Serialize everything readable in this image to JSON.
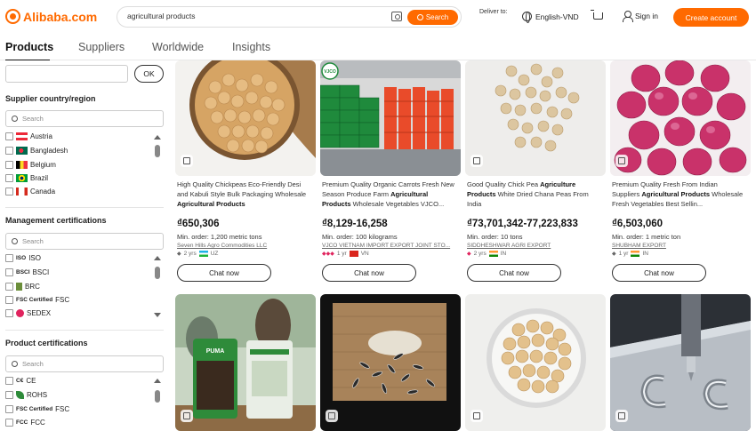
{
  "header": {
    "logo_text": "Alibaba.com",
    "search_value": "agricultural products",
    "search_button": "Search",
    "deliver_to": "Deliver to:",
    "language": "English-VND",
    "sign_in": "Sign in",
    "create_account": "Create account"
  },
  "tabs": [
    {
      "label": "Products",
      "active": true
    },
    {
      "label": "Suppliers",
      "active": false
    },
    {
      "label": "Worldwide",
      "active": false
    },
    {
      "label": "Insights",
      "active": false
    }
  ],
  "sidebar": {
    "ok_label": "OK",
    "country": {
      "title": "Supplier country/region",
      "search_placeholder": "Search",
      "options": [
        "Austria",
        "Bangladesh",
        "Belgium",
        "Brazil",
        "Canada"
      ]
    },
    "management": {
      "title": "Management certifications",
      "search_placeholder": "Search",
      "options": [
        {
          "badge": "ISO",
          "label": "ISO"
        },
        {
          "badge": "BSCI",
          "label": "BSCI"
        },
        {
          "badge": "",
          "label": "BRC"
        },
        {
          "badge": "FSC Certified",
          "label": "FSC"
        },
        {
          "badge": "",
          "label": "SEDEX"
        }
      ]
    },
    "product": {
      "title": "Product certifications",
      "search_placeholder": "Search",
      "options": [
        {
          "badge": "C€",
          "label": "CE"
        },
        {
          "badge": "",
          "label": "ROHS"
        },
        {
          "badge": "FSC Certified",
          "label": "FSC"
        },
        {
          "badge": "FCC",
          "label": "FCC"
        }
      ]
    }
  },
  "products": [
    {
      "title_pre": "High Quality Chickpeas Eco-Friendly Desi and Kabuli Style Bulk Packaging Wholesale ",
      "title_bold": "Agricultural Products",
      "title_post": "",
      "price": "₫650,306",
      "moq": "Min. order: 1,200 metric tons",
      "supplier": "Seven Hills Agro Commodities LLC",
      "meta": "2 yrs",
      "country": "UZ"
    },
    {
      "title_pre": "Premium Quality Organic Carrots Fresh New Season Produce Farm ",
      "title_bold": "Agricultural Products",
      "title_post": " Wholesale Vegetables VJCO...",
      "price": "₫8,129-16,258",
      "moq": "Min. order: 100 kilograms",
      "supplier": "VJCO VIETNAM IMPORT EXPORT JOINT STO...",
      "meta": "1 yr",
      "country": "VN"
    },
    {
      "title_pre": "Good Quality Chick Pea ",
      "title_bold": "Agriculture Products",
      "title_post": " White Dried Chana Peas From India",
      "price": "₫73,701,342-77,223,833",
      "moq": "Min. order: 10 tons",
      "supplier": "SIDDHESHWAR AGRI EXPORT",
      "meta": "2 yrs",
      "country": "IN"
    },
    {
      "title_pre": "Premium Quality Fresh From Indian Suppliers ",
      "title_bold": "Agricultural Products",
      "title_post": " Wholesale Fresh Vegetables Best Sellin...",
      "price": "₫6,503,060",
      "moq": "Min. order: 1 metric ton",
      "supplier": "SHUBHAM EXPORT",
      "meta": "1 yr",
      "country": "IN"
    }
  ],
  "chat_label": "Chat now",
  "carton_label": "VJCO",
  "bag_brand": "PUMA",
  "colors": {
    "accent": "#ff6a00"
  }
}
